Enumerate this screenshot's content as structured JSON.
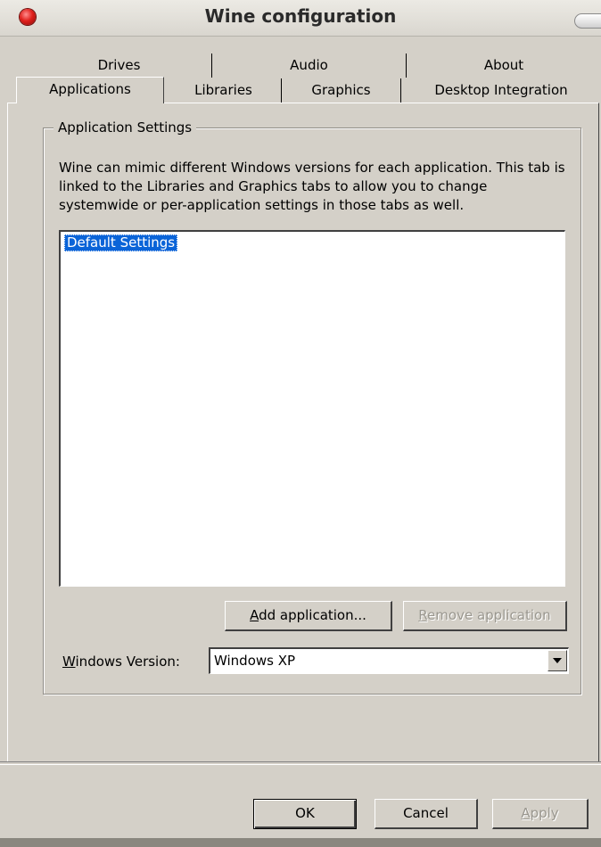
{
  "window": {
    "title": "Wine configuration"
  },
  "tabs": {
    "row1": [
      "Drives",
      "Audio",
      "About"
    ],
    "row2": [
      "Applications",
      "Libraries",
      "Graphics",
      "Desktop Integration"
    ],
    "active": "Applications"
  },
  "group": {
    "legend": "Application Settings",
    "description": "Wine can mimic different Windows versions for each application.  This tab is linked to the Libraries and Graphics tabs to allow you to change systemwide or per-application settings in those tabs as well."
  },
  "apps_list": {
    "items": [
      "Default Settings"
    ],
    "selected": "Default Settings"
  },
  "buttons": {
    "add_application": {
      "mnemonic": "A",
      "rest": "dd application..."
    },
    "remove_application": {
      "mnemonic": "R",
      "rest": "emove application"
    }
  },
  "windows_version": {
    "label_mnemonic": "W",
    "label_rest": "indows Version:",
    "value": "Windows XP"
  },
  "dialog_buttons": {
    "ok": "OK",
    "cancel": "Cancel",
    "apply_mnemonic": "A",
    "apply_rest": "pply"
  },
  "colors": {
    "selection": "#0a64d8",
    "face": "#d4d0c8",
    "close": "#e0201c"
  }
}
